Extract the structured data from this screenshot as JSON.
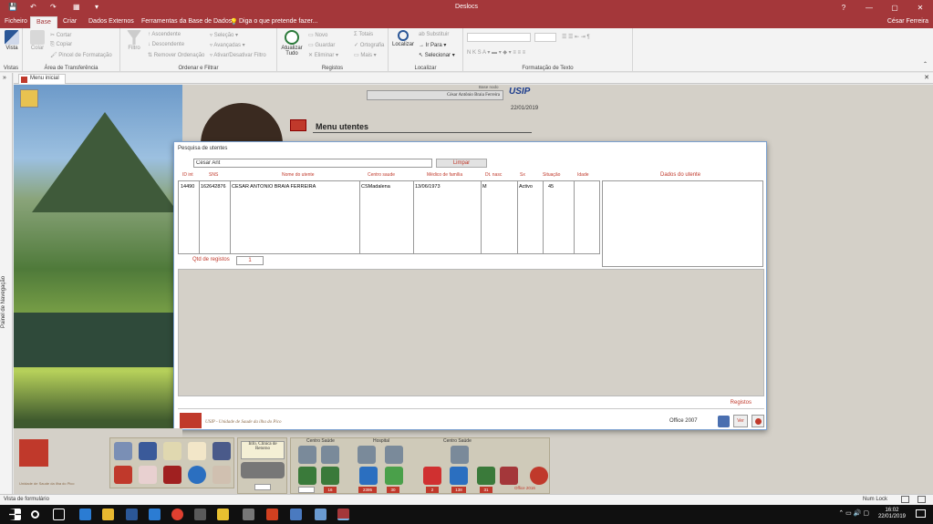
{
  "window": {
    "title": "Deslocs",
    "controls": [
      "?",
      "—",
      "▢",
      "✕"
    ]
  },
  "quick_access": [
    "💾",
    "↶",
    "↷",
    "▦",
    "▾"
  ],
  "menu": {
    "tabs": [
      "Ficheiro",
      "Base",
      "Criar",
      "Dados Externos",
      "Ferramentas da Base de Dados"
    ],
    "tell_me": "Diga o que pretende fazer...",
    "user": "César Ferreira"
  },
  "ribbon": {
    "groups": {
      "vistas": "Vistas",
      "clipboard": "Área de Transferência",
      "sort_filter": "Ordenar e Filtrar",
      "records": "Registos",
      "find": "Localizar",
      "text_format": "Formatação de Texto"
    },
    "vista": "Vista",
    "colar": "Colar",
    "cortar": "Cortar",
    "copiar": "Copiar",
    "pincel": "Pincel de Formatação",
    "filtro": "Filtro",
    "ascendente": "Ascendente",
    "descendente": "Descendente",
    "remover_ordenacao": "Remover Ordenação",
    "selecao": "Seleção",
    "avancadas": "Avançadas",
    "ativar_filtro": "Ativar/Desativar Filtro",
    "atualizar": "Atualizar",
    "atualizar2": "Tudo",
    "novo": "Novo",
    "guardar": "Guardar",
    "eliminar": "Eliminar",
    "totais": "Totais",
    "ortografia": "Ortografia",
    "mais": "Mais",
    "localizar": "Localizar",
    "substituir": "Substituir",
    "ir_para": "Ir Para",
    "selecionar": "Selecionar"
  },
  "nav_pane": {
    "label": "Painel de Navegação",
    "toggle": "»"
  },
  "doc_tab": {
    "label": "Menu inicial",
    "close": "✕"
  },
  "form": {
    "header_small": "Base nodo",
    "header_name": "César Antônio Braia Ferreira",
    "logo_text": "USIP",
    "date": "22/01/2019",
    "menu_title": "Menu utentes"
  },
  "dialog": {
    "title": "Pesquisa de utentes",
    "search_value": "César Ant",
    "clear_button": "Limpar",
    "columns": [
      "ID int",
      "SNS",
      "Nome do utente",
      "Centro saude",
      "Médico de família",
      "Dt. nasc",
      "Sx",
      "Situação",
      "Idade"
    ],
    "rows": [
      [
        "14490",
        "162642876",
        "CÉSAR ANTÔNIO BRAIA FERREIRA",
        "CSMadalena",
        "13/06/1973",
        "M",
        "Activo",
        "45",
        ""
      ]
    ],
    "details_label": "Dados do utente",
    "records_count_label": "Qtd de registos",
    "records_count": "1",
    "registos": "Registos",
    "footer_text": "USIP - Unidade de Saude da ilha do Pico",
    "office_badge": "Office 2007",
    "ver_button": "Ver"
  },
  "toolbar": {
    "info_clinica": "Info. Clínica de Retorno",
    "centro_saude": "Centro Saúde",
    "hospital": "Hospital",
    "centro_saude2": "Centro Saúde",
    "counts": [
      "16",
      "2395",
      "30",
      "2",
      "138",
      "31"
    ],
    "office_badge": "Office 2016",
    "brand_caption": "Unidade de Saude da ilha do Pico"
  },
  "status": {
    "left": "Vista de formulário",
    "right": "Num Lock"
  },
  "taskbar": {
    "time": "16:02",
    "date": "22/01/2019"
  },
  "colors": {
    "accent": "#a4373a",
    "label_red": "#c0392b",
    "form_bg": "#d4d0c8"
  }
}
